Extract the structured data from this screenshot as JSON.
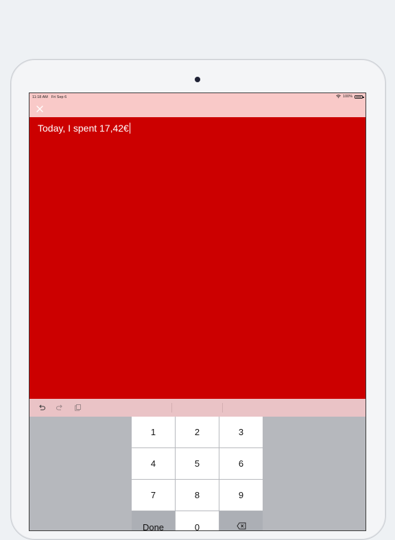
{
  "status_bar": {
    "time": "11:18 AM",
    "date": "Fri Sep 6",
    "battery": "100%"
  },
  "editor": {
    "text": "Today, I spent 17,42€"
  },
  "colors": {
    "editor_background": "#cc0000",
    "bar_background": "#f9c9c8",
    "shortcut_bar": "#eac3c6",
    "keyboard_background": "#b6b8bd"
  },
  "keypad": {
    "keys": [
      "1",
      "2",
      "3",
      "4",
      "5",
      "6",
      "7",
      "8",
      "9"
    ],
    "done_label": "Done",
    "zero_label": "0",
    "delete_icon": "backspace-icon"
  },
  "toolbar_icons": [
    "close-icon",
    "undo-icon",
    "redo-icon",
    "paste-icon"
  ]
}
